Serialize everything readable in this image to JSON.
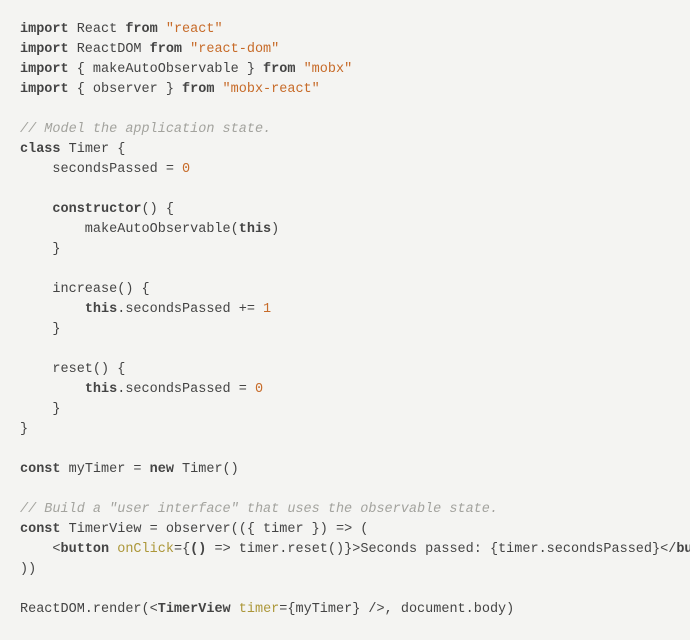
{
  "code": {
    "line1_kw1": "import",
    "line1_id": " React ",
    "line1_kw2": "from",
    "line1_sp": " ",
    "line1_str": "\"react\"",
    "line2_kw1": "import",
    "line2_id": " ReactDOM ",
    "line2_kw2": "from",
    "line2_sp": " ",
    "line2_str": "\"react-dom\"",
    "line3_kw1": "import",
    "line3_id": " { makeAutoObservable } ",
    "line3_kw2": "from",
    "line3_sp": " ",
    "line3_str": "\"mobx\"",
    "line4_kw1": "import",
    "line4_id": " { observer } ",
    "line4_kw2": "from",
    "line4_sp": " ",
    "line4_str": "\"mobx-react\"",
    "cmt1": "// Model the application state.",
    "cls_kw": "class",
    "cls_name": " Timer {",
    "fld_name": "    secondsPassed = ",
    "fld_val": "0",
    "ctor_name": "    constructor",
    "ctor_paren": "() {",
    "ctor_body1": "        makeAutoObservable(",
    "ctor_this": "this",
    "ctor_body2": ")",
    "close_br": "    }",
    "inc_name": "    increase",
    "inc_paren": "() {",
    "inc_pre": "        ",
    "inc_this": "this",
    "inc_mid": ".secondsPassed += ",
    "inc_val": "1",
    "rst_name": "    reset",
    "rst_paren": "() {",
    "rst_pre": "        ",
    "rst_this": "this",
    "rst_mid": ".secondsPassed = ",
    "rst_val": "0",
    "cls_close": "}",
    "mt_kw": "const",
    "mt_name": " myTimer = ",
    "mt_new": "new",
    "mt_call": " Timer()",
    "cmt2": "// Build a \"user interface\" that uses the observable state.",
    "tv_kw": "const",
    "tv_name": " TimerView = observer((",
    "tv_destr": "{ timer }",
    "tv_arrow": ") => (",
    "jsx_open1": "    <",
    "jsx_btn1": "button",
    "jsx_sp": " ",
    "jsx_attr": "onClick",
    "jsx_eq": "=",
    "jsx_brace1": "{",
    "jsx_arrow_open": "(",
    "jsx_arrow_close": ")",
    "jsx_arrow_body": " => timer.reset()",
    "jsx_brace2": "}",
    "jsx_gt": ">",
    "jsx_text1": "Seconds passed: ",
    "jsx_ibrace1": "{",
    "jsx_expr": "timer.secondsPassed",
    "jsx_ibrace2": "}",
    "jsx_close": "</",
    "jsx_btn2": "button",
    "jsx_end": ">",
    "tv_close": "))",
    "rd_pre": "ReactDOM.render(<",
    "rd_comp": "TimerView",
    "rd_sp": " ",
    "rd_attr": "timer",
    "rd_eq": "=",
    "rd_b1": "{",
    "rd_val": "myTimer",
    "rd_b2": "}",
    "rd_selfclose": " />, ",
    "rd_doc": "document",
    "rd_body": ".body)"
  }
}
